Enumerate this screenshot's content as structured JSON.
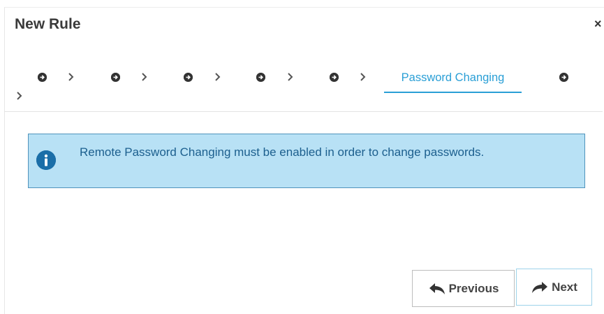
{
  "dialog": {
    "title": "New Rule",
    "close_glyph": "×"
  },
  "wizard": {
    "steps": [
      {
        "icon": "arrow-circle-right-icon"
      },
      {
        "icon": "arrow-circle-right-icon"
      },
      {
        "icon": "arrow-circle-right-icon"
      },
      {
        "icon": "arrow-circle-right-icon"
      },
      {
        "icon": "arrow-circle-right-icon"
      },
      {
        "label": "Password Changing",
        "active": true
      },
      {
        "icon": "arrow-circle-right-icon"
      }
    ],
    "separator_glyph": "›",
    "accent_color": "#2a9fd6"
  },
  "alert": {
    "icon": "info-icon",
    "message": "Remote Password Changing must be enabled in order to change passwords.",
    "background": "#b8e1f5",
    "text_color": "#1c5f8e"
  },
  "footer": {
    "previous_label": "Previous",
    "previous_icon": "reply-arrow-icon",
    "next_label": "Next",
    "next_icon": "forward-arrow-icon"
  }
}
